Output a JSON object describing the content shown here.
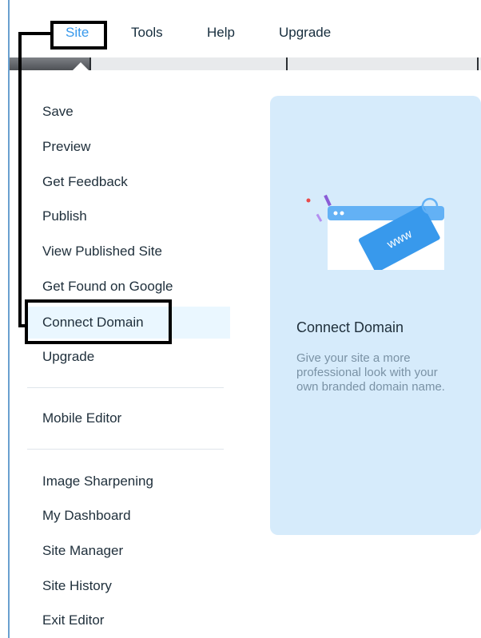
{
  "topbar": {
    "items": [
      {
        "label": "Site"
      },
      {
        "label": "Tools"
      },
      {
        "label": "Help"
      },
      {
        "label": "Upgrade"
      }
    ]
  },
  "menu": {
    "group1": [
      "Save",
      "Preview",
      "Get Feedback",
      "Publish",
      "View Published Site",
      "Get Found on Google",
      "Connect Domain",
      "Upgrade"
    ],
    "group2": [
      "Mobile Editor"
    ],
    "group3": [
      "Image Sharpening",
      "My Dashboard",
      "Site Manager",
      "Site History",
      "Exit Editor"
    ],
    "active": "Connect Domain"
  },
  "card": {
    "title": "Connect Domain",
    "description": "Give your site a more professional look with your own branded domain name.",
    "tag_text": "www"
  },
  "colors": {
    "accent": "#3899ec",
    "card_bg": "#d6ebfb",
    "active_bg": "#eaf7ff",
    "annotation": "#000000"
  }
}
